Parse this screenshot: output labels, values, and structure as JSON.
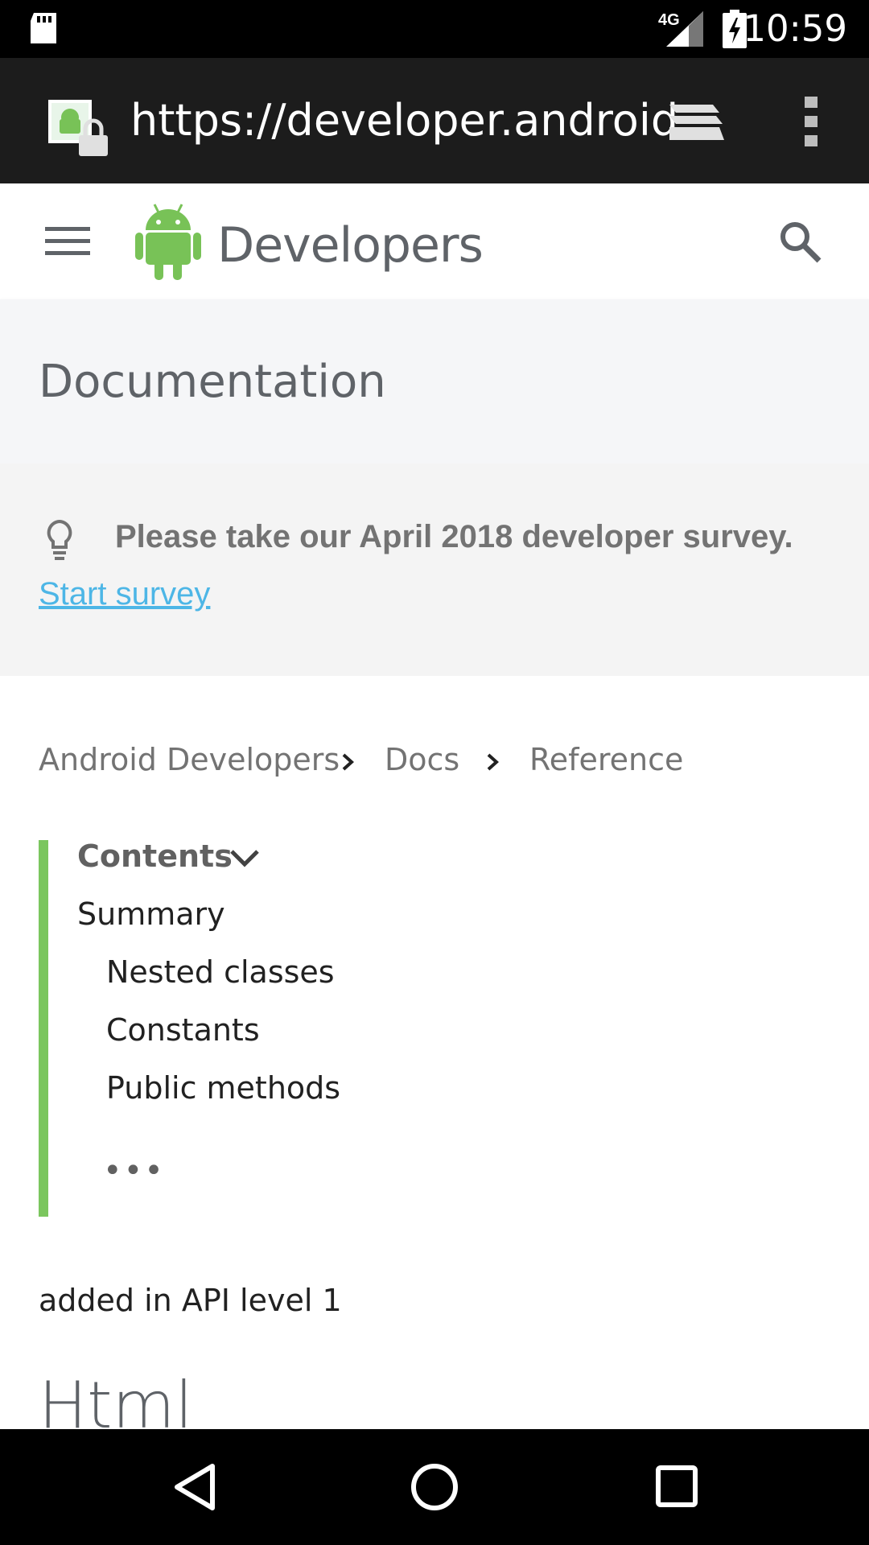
{
  "status_bar": {
    "time": "10:59",
    "network": "4G"
  },
  "browser": {
    "url": "https://developer.android"
  },
  "header": {
    "brand": "Developers"
  },
  "page": {
    "section_title": "Documentation"
  },
  "survey": {
    "message": "Please take our April 2018 developer survey.",
    "link": "Start survey"
  },
  "breadcrumbs": [
    "Android Developers",
    "Docs",
    "Reference"
  ],
  "contents": {
    "title": "Contents",
    "items": [
      "Summary",
      "Nested classes",
      "Constants",
      "Public methods"
    ],
    "more": "•••"
  },
  "api_level": "added in API level 1",
  "class_title": "Html",
  "colors": {
    "android_green": "#78c257",
    "link_blue": "#4db6e6",
    "contents_bar": "#7bc65e"
  }
}
